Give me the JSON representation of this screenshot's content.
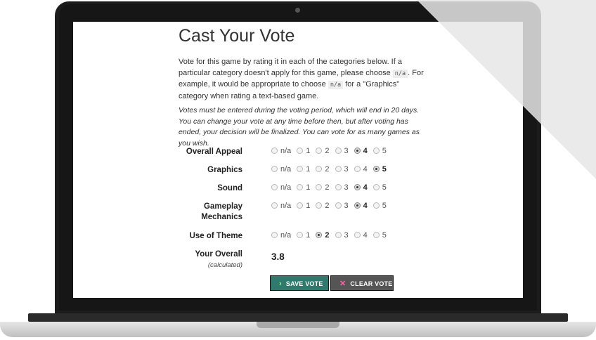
{
  "page": {
    "title": "Cast Your Vote",
    "intro": {
      "part1": "Vote for this game by rating it in each of the categories below. If a particular category doesn't apply for this game, please choose ",
      "code1": "n/a",
      "part2": ". For example, it would be appropriate to choose ",
      "code2": "n/a",
      "part3": " for a \"Graphics\" category when rating a text-based game."
    },
    "note": "Votes must be entered during the voting period, which will end in 20 days. You can change your vote at any time before then, but after voting has ended, your decision will be finalized. You can vote for as many games as you wish."
  },
  "options": [
    "n/a",
    "1",
    "2",
    "3",
    "4",
    "5"
  ],
  "categories": [
    {
      "label": "Overall Appeal",
      "selected": "4"
    },
    {
      "label": "Graphics",
      "selected": "5"
    },
    {
      "label": "Sound",
      "selected": "4"
    },
    {
      "label": "Gameplay Mechanics",
      "selected": "4"
    },
    {
      "label": "Use of Theme",
      "selected": "2"
    }
  ],
  "overall": {
    "label": "Your Overall",
    "sub": "(calculated)",
    "value": "3.8"
  },
  "buttons": {
    "save": "SAVE VOTE",
    "save_icon": "chevron-right-icon",
    "clear": "CLEAR VOTE",
    "clear_icon": "x-icon"
  },
  "colors": {
    "save_bg": "#2f7a6c",
    "clear_bg": "#555555"
  }
}
